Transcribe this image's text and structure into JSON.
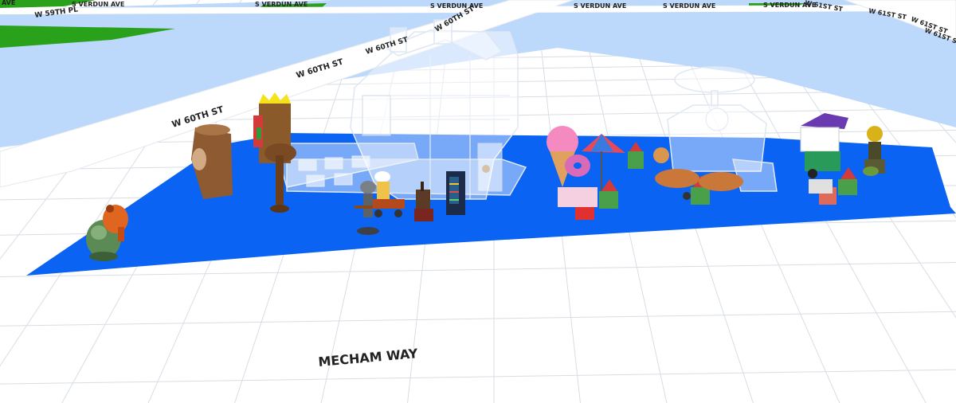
{
  "colors": {
    "ground": "#ffffff",
    "grid": "#d8dde5",
    "sky_lot": "#bcd8fb",
    "grass": "#2aa11a",
    "plot": "#0a63f3"
  },
  "streets": {
    "w59th_pl": "W 59TH PL",
    "verdun_ave": "S VERDUN AVE",
    "w60th_st": "W 60TH ST",
    "w61st_st": "W 61ST ST",
    "avenue_edge": "AVE",
    "mecham_way": "MECHAM WAY"
  },
  "objects": {
    "buildings": [
      "ghost-house",
      "ghost-hotdog-stand"
    ],
    "props": [
      "green-monster-statue",
      "orange-monster-statue",
      "tree-stump-statue",
      "tiki-totem",
      "wooden-sign-post",
      "patio-seating",
      "robot-statue",
      "chef-hot-dog-cart",
      "bbq-grill",
      "vending-machine",
      "ice-cream-cone-statue",
      "donut-cart",
      "striped-umbrella",
      "gnome-figures",
      "hot-dog-car",
      "purple-food-cart",
      "gold-robot-statue"
    ]
  }
}
